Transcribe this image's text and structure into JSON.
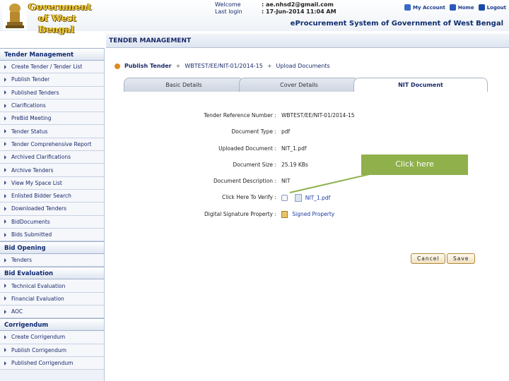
{
  "header": {
    "gov_line1": "Government",
    "gov_line2": "of West Bengal",
    "welcome_label": "Welcome",
    "welcome_value": ": ae.nhsd2@gmail.com",
    "lastlogin_label": "Last login",
    "lastlogin_value": ": 17-Jun-2014 11:04 AM",
    "links": {
      "account": "My Account",
      "home": "Home",
      "logout": "Logout"
    },
    "system_title": "eProcurement System of Government of West Bengal"
  },
  "page_title": "TENDER MANAGEMENT",
  "sidebar": {
    "sections": [
      {
        "title": "Tender Management",
        "items": [
          "Create Tender / Tender List",
          "Publish Tender",
          "Published Tenders",
          "Clarifications",
          "PreBid Meeting",
          "Tender Status",
          "Tender Comprehensive Report",
          "Archived Clarifications",
          "Archive Tenders",
          "View My Space List",
          "Enlisted Bidder Search",
          "Downloaded Tenders",
          "BidDocuments",
          "Bids Submitted"
        ]
      },
      {
        "title": "Bid Opening",
        "items": [
          "Tenders"
        ]
      },
      {
        "title": "Bid Evaluation",
        "items": [
          "Technical Evaluation",
          "Financial Evaluation",
          "AOC"
        ]
      },
      {
        "title": "Corrigendum",
        "items": [
          "Create Corrigendum",
          "Publish Corrigendum",
          "Published Corrigendum"
        ]
      }
    ]
  },
  "breadcrumb": {
    "item1": "Publish Tender",
    "item2": "WBTEST/EE/NIT-01/2014-15",
    "item3": "Upload Documents"
  },
  "tabs": [
    "Basic Details",
    "Cover Details",
    "NIT Document"
  ],
  "form": {
    "ref_label": "Tender Reference Number",
    "ref_value": "WBTEST/EE/NIT-01/2014-15",
    "type_label": "Document Type",
    "type_value": "pdf",
    "uploaded_label": "Uploaded Document",
    "uploaded_value": "NIT_1.pdf",
    "size_label": "Document Size",
    "size_value": "25.19  KBs",
    "desc_label": "Document Description",
    "desc_value": "NIT",
    "verify_label": "Click Here To Verify",
    "verify_file": "NIT_1.pdf",
    "sig_label": "Digital Signature Property",
    "sig_value": "Signed Property"
  },
  "buttons": {
    "cancel": "Cancel",
    "save": "Save"
  },
  "callout": {
    "text": "Click here",
    "color": "#8fb04b"
  }
}
